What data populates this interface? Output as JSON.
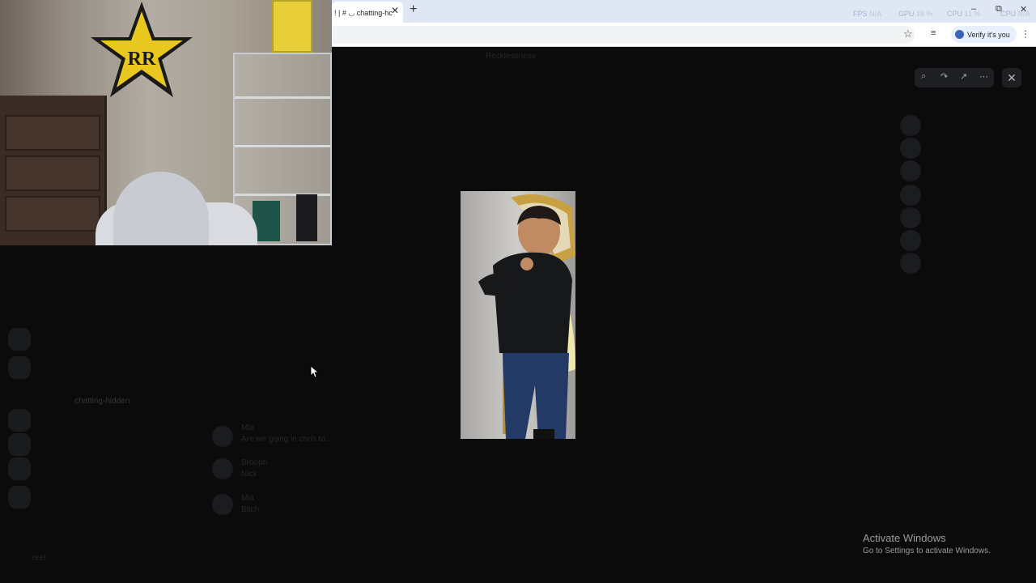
{
  "browser": {
    "tab_title": "! | # ◡ chatting-hc",
    "tab_close_icon": "close-icon",
    "new_tab_icon": "plus-icon",
    "verify_label": "Verify it's you",
    "overlay_stats": {
      "fps_label": "FPS",
      "fps_value": "N/A",
      "gpu_label": "GPU",
      "gpu_value": "16 %",
      "cpu_label": "CPU",
      "cpu_value": "11 %",
      "extra_label": "CPU",
      "extra_value": "N/A"
    },
    "window_buttons": {
      "minimize": "–",
      "restore": "⧉",
      "close": "✕"
    }
  },
  "viewer": {
    "tools": [
      "zoom-in-icon",
      "forward-icon",
      "open-external-icon",
      "more-icon"
    ],
    "tool_glyphs": [
      "⌕",
      "↷",
      "↗",
      "⋯"
    ],
    "close_glyph": "✕"
  },
  "background_app": {
    "server_header": "Recklessness",
    "active_channel": "chatting-hidden",
    "messages": [
      {
        "author": "Mia",
        "text": "Are we going in chris to…"
      },
      {
        "author": "Brooph",
        "text": "Nick"
      },
      {
        "author": "Mia",
        "text": "Bitch"
      }
    ],
    "user": "reel"
  },
  "activate_windows": {
    "title": "Activate Windows",
    "subtitle": "Go to Settings to activate Windows."
  },
  "colors": {
    "accent": "#3c64b4",
    "tabstrip": "#dfe7f5",
    "background": "#0b0b0c"
  }
}
